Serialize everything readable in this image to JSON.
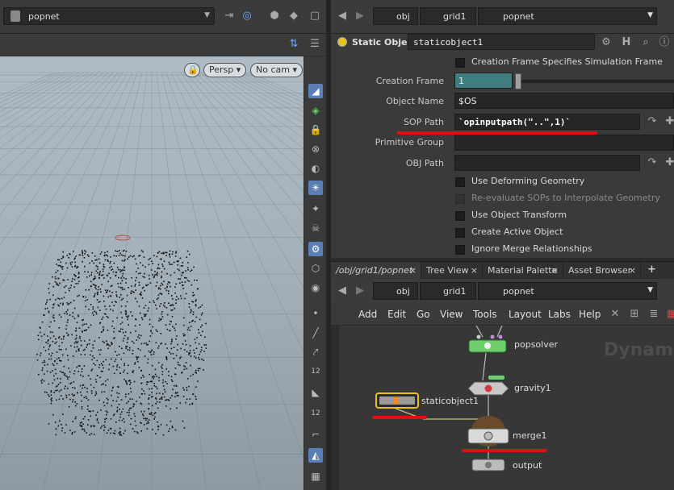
{
  "viewport": {
    "path": "popnet",
    "view_mode": "Persp",
    "camera": "No cam"
  },
  "param_pane": {
    "breadcrumb": [
      "obj",
      "grid1",
      "popnet"
    ],
    "node_type": "Static Object",
    "node_name": "staticobject1",
    "params": {
      "creation_frame_flag": "Creation Frame Specifies Simulation Frame",
      "creation_frame_label": "Creation Frame",
      "creation_frame_value": "1",
      "object_name_label": "Object Name",
      "object_name_value": "$OS",
      "sop_path_label": "SOP Path",
      "sop_path_value": "`opinputpath(\"..\",1)`",
      "primitive_group_label": "Primitive Group",
      "obj_path_label": "OBJ Path"
    },
    "checkboxes": [
      {
        "label": "Use Deforming Geometry",
        "enabled": true
      },
      {
        "label": "Re-evaluate SOPs to Interpolate Geometry",
        "enabled": false
      },
      {
        "label": "Use Object Transform",
        "enabled": true
      },
      {
        "label": "Create Active Object",
        "enabled": true
      },
      {
        "label": "Ignore Merge Relationships",
        "enabled": true
      }
    ]
  },
  "network": {
    "tabs": [
      "/obj/grid1/popnet",
      "Tree View",
      "Material Palette",
      "Asset Browser",
      "+"
    ],
    "breadcrumb": [
      "obj",
      "grid1",
      "popnet"
    ],
    "menu": [
      "Add",
      "Edit",
      "Go",
      "View",
      "Tools",
      "Layout",
      "Labs",
      "Help"
    ],
    "watermark": "Dynami",
    "nodes": [
      {
        "name": "popsolver"
      },
      {
        "name": "gravity1"
      },
      {
        "name": "staticobject1"
      },
      {
        "name": "merge1"
      },
      {
        "name": "output"
      }
    ]
  },
  "colors": {
    "accent_teal": "#3f7e80",
    "highlight_red": "#e01010",
    "selected_node": "#e8c21a",
    "solver_green": "#6fcf6f"
  }
}
